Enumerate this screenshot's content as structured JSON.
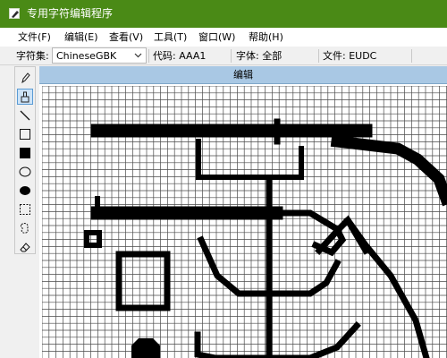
{
  "app": {
    "title": "专用字符编辑程序"
  },
  "menu": [
    {
      "label": "文件(F)"
    },
    {
      "label": "编辑(E)"
    },
    {
      "label": "查看(V)"
    },
    {
      "label": "工具(T)"
    },
    {
      "label": "窗口(W)"
    },
    {
      "label": "帮助(H)"
    }
  ],
  "infobar": {
    "charset_label": "字符集:",
    "charset_value": "ChineseGBK",
    "code": "代码: AAA1",
    "font": "字体: 全部",
    "file": "文件: EUDC"
  },
  "tools": [
    {
      "icon": "pencil-icon"
    },
    {
      "icon": "brush-icon",
      "active": true
    },
    {
      "icon": "line-icon"
    },
    {
      "icon": "hollow-rectangle-icon"
    },
    {
      "icon": "filled-rectangle-icon"
    },
    {
      "icon": "hollow-ellipse-icon"
    },
    {
      "icon": "filled-ellipse-icon"
    },
    {
      "icon": "rectangular-select-icon"
    },
    {
      "icon": "freeform-select-icon"
    },
    {
      "icon": "eraser-icon"
    }
  ],
  "editor": {
    "title": "编辑",
    "grid_color": "#4a4a4a",
    "pixel_color": "#000000"
  },
  "colors": {
    "titlebar": "#4a8a16",
    "editor_header": "#a9c8e4",
    "active_tool": "#cde3f7"
  }
}
